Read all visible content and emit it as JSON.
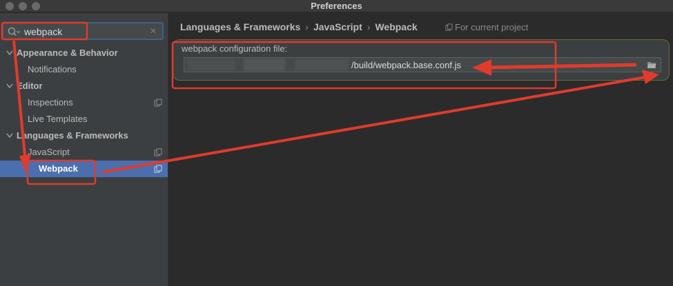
{
  "window": {
    "title": "Preferences"
  },
  "search": {
    "value": "webpack",
    "clear_glyph": "✕"
  },
  "sidebar": {
    "items": [
      {
        "label": "Appearance & Behavior",
        "bold": true,
        "expanded": true
      },
      {
        "label": "Notifications"
      },
      {
        "label": "Editor",
        "bold": true,
        "expanded": true
      },
      {
        "label": "Inspections"
      },
      {
        "label": "Live Templates"
      },
      {
        "label": "Languages & Frameworks",
        "bold": true,
        "expanded": true
      },
      {
        "label": "JavaScript"
      },
      {
        "label": "Webpack",
        "selected": true
      }
    ]
  },
  "breadcrumb": {
    "items": [
      "Languages & Frameworks",
      "JavaScript",
      "Webpack"
    ],
    "separator": "›"
  },
  "scope": {
    "label": "For current project"
  },
  "config": {
    "label": "webpack configuration file:",
    "path_visible": "/build/webpack.base.conf.js"
  },
  "colors": {
    "selection": "#4b6eaf",
    "annotation": "#e03b2c",
    "focus_border": "#3d6185"
  },
  "icons": {
    "search": "search-icon",
    "clear": "close-icon",
    "chevron": "chevron-down-icon",
    "copy": "copy-icon",
    "folder": "folder-icon"
  }
}
